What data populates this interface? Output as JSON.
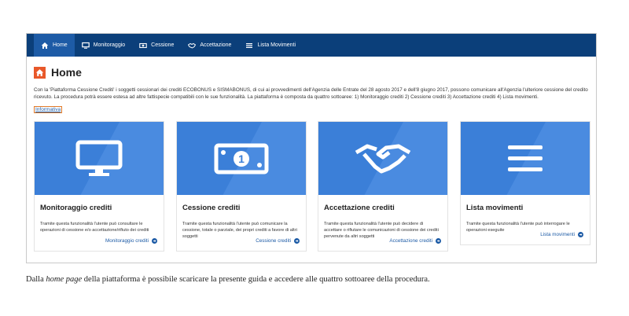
{
  "nav": {
    "items": [
      {
        "label": "Home",
        "icon": "home-icon",
        "active": true
      },
      {
        "label": "Monitoraggio",
        "icon": "monitor-icon",
        "active": false
      },
      {
        "label": "Cessione",
        "icon": "money-icon",
        "active": false
      },
      {
        "label": "Accettazione",
        "icon": "handshake-icon",
        "active": false
      },
      {
        "label": "Lista Movimenti",
        "icon": "list-icon",
        "active": false
      }
    ]
  },
  "page": {
    "title": "Home",
    "intro": "Con la 'Piattaforma Cessione Crediti' i soggetti cessionari dei crediti ECOBONUS e SISMABONUS, di cui ai provvedimenti dell'Agenzia delle Entrate del 28 agosto 2017 e dell'8 giugno 2017, possono comunicare all'Agenzia l'ulteriore cessione del credito ricevuto. La procedura potrà essere estesa ad altre fattispecie compatibili con le sue funzionalità. La piattaforma è composta da quattro sottoaree: 1) Monitoraggio crediti 2) Cessione crediti 3) Accettazione crediti 4) Lista movimenti.",
    "info_link": "Informativa"
  },
  "cards": [
    {
      "title": "Monitoraggio crediti",
      "icon": "monitor-icon",
      "desc": "Tramite questa funzionalità l'utente può consultare le operazioni di cessione e/o accettazione/rifiuto dei crediti",
      "link": "Monitoraggio crediti"
    },
    {
      "title": "Cessione crediti",
      "icon": "money-icon",
      "desc": "Tramite questa funzionalità l'utente può comunicare la cessione, totale o parziale, dei propri crediti a favore di altri soggetti",
      "link": "Cessione crediti"
    },
    {
      "title": "Accettazione crediti",
      "icon": "handshake-icon",
      "desc": "Tramite questa funzionalità l'utente può decidere di accettare o rifiutare le comunicazioni di cessione dei crediti pervenute da altri soggetti",
      "link": "Accettazione crediti"
    },
    {
      "title": "Lista movimenti",
      "icon": "list-icon",
      "desc": "Tramite questa funzionalità l'utente può interrogare le operazioni eseguite",
      "link": "Lista movimenti"
    }
  ],
  "caption": {
    "prefix": "Dalla ",
    "emphasis": "home page",
    "suffix": " della piattaforma è possibile scaricare la presente guida e accedere alle quattro sottoaree della procedura."
  },
  "colors": {
    "navbar": "#0b3f7a",
    "nav_active": "#1d5ba6",
    "card_hero": "#3b7fd8",
    "accent": "#e8582a",
    "link": "#1d5ba6"
  }
}
